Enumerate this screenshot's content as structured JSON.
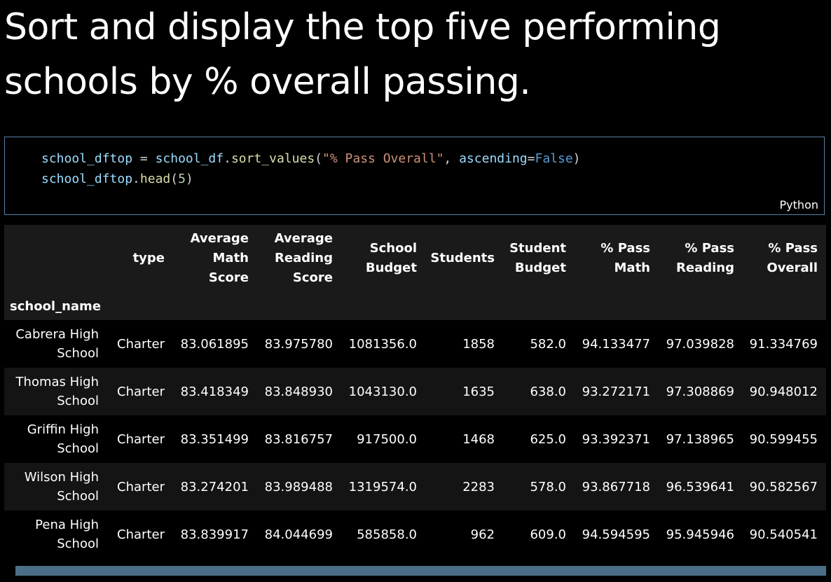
{
  "markdown": {
    "heading": "Sort and display the top five performing schools by % overall passing."
  },
  "code_cell": {
    "line1": {
      "var": "school_dftop",
      "eq": " = ",
      "obj": "school_df",
      "dot": ".",
      "method": "sort_values",
      "open": "(",
      "arg_str": "\"% Pass Overall\"",
      "comma": ", ",
      "kwarg": "ascending",
      "kw_eq": "=",
      "kw_val": "False",
      "close": ")"
    },
    "line2": {
      "obj": "school_dftop",
      "dot": ".",
      "method": "head",
      "open": "(",
      "num": "5",
      "close": ")"
    },
    "language": "Python"
  },
  "output": {
    "columns": [
      "type",
      "Average Math Score",
      "Average Reading Score",
      "School Budget",
      "Students",
      "Student Budget",
      "% Pass Math",
      "% Pass Reading",
      "% Pass Overall"
    ],
    "index_name": "school_name",
    "rows": [
      {
        "name": "Cabrera High School",
        "cells": [
          "Charter",
          "83.061895",
          "83.975780",
          "1081356.0",
          "1858",
          "582.0",
          "94.133477",
          "97.039828",
          "91.334769"
        ]
      },
      {
        "name": "Thomas High School",
        "cells": [
          "Charter",
          "83.418349",
          "83.848930",
          "1043130.0",
          "1635",
          "638.0",
          "93.272171",
          "97.308869",
          "90.948012"
        ]
      },
      {
        "name": "Griffin High School",
        "cells": [
          "Charter",
          "83.351499",
          "83.816757",
          "917500.0",
          "1468",
          "625.0",
          "93.392371",
          "97.138965",
          "90.599455"
        ]
      },
      {
        "name": "Wilson High School",
        "cells": [
          "Charter",
          "83.274201",
          "83.989488",
          "1319574.0",
          "2283",
          "578.0",
          "93.867718",
          "96.539641",
          "90.582567"
        ]
      },
      {
        "name": "Pena High School",
        "cells": [
          "Charter",
          "83.839917",
          "84.044699",
          "585858.0",
          "962",
          "609.0",
          "94.594595",
          "95.945946",
          "90.540541"
        ]
      }
    ]
  },
  "colors": {
    "background": "#000000",
    "cell_border": "#5a7fa6",
    "header_bg": "#1a1a1a",
    "row_alt_bg": "#141414",
    "scrollbar": "#4a6f86"
  }
}
